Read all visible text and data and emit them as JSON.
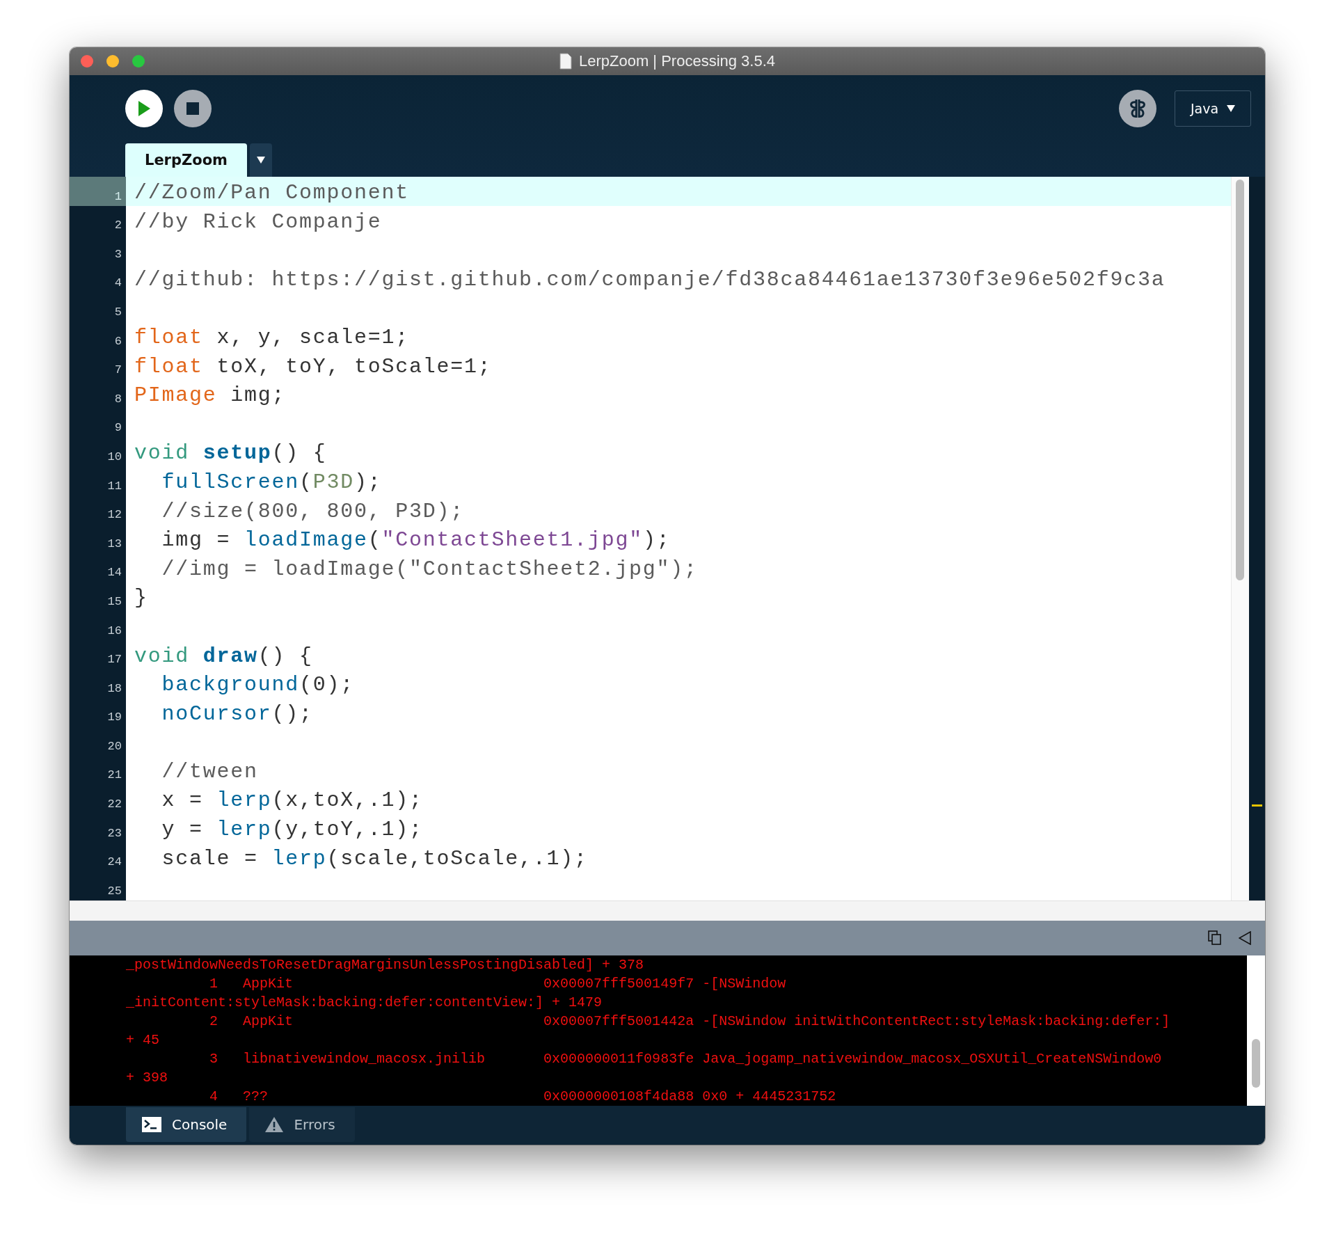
{
  "window": {
    "title": "LerpZoom | Processing 3.5.4"
  },
  "toolbar": {
    "mode": "Java"
  },
  "tabs": [
    {
      "label": "LerpZoom",
      "selected": true
    }
  ],
  "editor": {
    "lines": [
      {
        "number": "1",
        "selected": true,
        "tokens": [
          {
            "kind": "comment",
            "text": "//Zoom/Pan Component"
          }
        ]
      },
      {
        "number": "2",
        "selected": false,
        "tokens": [
          {
            "kind": "comment",
            "text": "//by Rick Companje"
          }
        ]
      },
      {
        "number": "3",
        "selected": false
      },
      {
        "number": "4",
        "selected": false,
        "tokens": [
          {
            "kind": "comment",
            "text": "//github: https://gist.github.com/companje/fd38ca84461ae13730f3e96e502f9c3a"
          }
        ]
      },
      {
        "number": "5",
        "selected": false
      },
      {
        "number": "6",
        "selected": false,
        "tokens": [
          {
            "kind": "type",
            "text": "float"
          },
          {
            "kind": "plain",
            "text": " x, y, scale=1;"
          }
        ]
      },
      {
        "number": "7",
        "selected": false,
        "tokens": [
          {
            "kind": "type",
            "text": "float"
          },
          {
            "kind": "plain",
            "text": " toX, toY, toScale=1;"
          }
        ]
      },
      {
        "number": "8",
        "selected": false,
        "tokens": [
          {
            "kind": "type",
            "text": "PImage"
          },
          {
            "kind": "plain",
            "text": " img;"
          }
        ]
      },
      {
        "number": "9",
        "selected": false
      },
      {
        "number": "10",
        "selected": false,
        "tokens": [
          {
            "kind": "keyword",
            "text": "void "
          },
          {
            "kind": "definition",
            "text": "setup"
          },
          {
            "kind": "plain",
            "text": "() {"
          }
        ]
      },
      {
        "number": "11",
        "selected": false,
        "tokens": [
          {
            "kind": "function",
            "text": "  fullScreen"
          },
          {
            "kind": "plain",
            "text": "("
          },
          {
            "kind": "constant",
            "text": "P3D"
          },
          {
            "kind": "plain",
            "text": ");"
          }
        ]
      },
      {
        "number": "12",
        "selected": false,
        "tokens": [
          {
            "kind": "comment",
            "text": "  //size(800, 800, P3D);"
          }
        ]
      },
      {
        "number": "13",
        "selected": false,
        "tokens": [
          {
            "kind": "plain",
            "text": "  img = "
          },
          {
            "kind": "function",
            "text": "loadImage"
          },
          {
            "kind": "plain",
            "text": "("
          },
          {
            "kind": "string",
            "text": "\"ContactSheet1.jpg\""
          },
          {
            "kind": "plain",
            "text": ");"
          }
        ]
      },
      {
        "number": "14",
        "selected": false,
        "tokens": [
          {
            "kind": "comment",
            "text": "  //img = loadImage(\"ContactSheet2.jpg\");"
          }
        ]
      },
      {
        "number": "15",
        "selected": false,
        "tokens": [
          {
            "kind": "plain",
            "text": "}"
          }
        ]
      },
      {
        "number": "16",
        "selected": false
      },
      {
        "number": "17",
        "selected": false,
        "tokens": [
          {
            "kind": "keyword",
            "text": "void "
          },
          {
            "kind": "definition",
            "text": "draw"
          },
          {
            "kind": "plain",
            "text": "() {"
          }
        ]
      },
      {
        "number": "18",
        "selected": false,
        "tokens": [
          {
            "kind": "function",
            "text": "  background"
          },
          {
            "kind": "plain",
            "text": "(0);"
          }
        ]
      },
      {
        "number": "19",
        "selected": false,
        "tokens": [
          {
            "kind": "function",
            "text": "  noCursor"
          },
          {
            "kind": "plain",
            "text": "();"
          }
        ]
      },
      {
        "number": "20",
        "selected": false
      },
      {
        "number": "21",
        "selected": false,
        "tokens": [
          {
            "kind": "comment",
            "text": "  //tween"
          }
        ]
      },
      {
        "number": "22",
        "selected": false,
        "tokens": [
          {
            "kind": "plain",
            "text": "  x = "
          },
          {
            "kind": "function",
            "text": "lerp"
          },
          {
            "kind": "plain",
            "text": "(x,toX,.1);"
          }
        ]
      },
      {
        "number": "23",
        "selected": false,
        "tokens": [
          {
            "kind": "plain",
            "text": "  y = "
          },
          {
            "kind": "function",
            "text": "lerp"
          },
          {
            "kind": "plain",
            "text": "(y,toY,.1);"
          }
        ]
      },
      {
        "number": "24",
        "selected": false,
        "tokens": [
          {
            "kind": "plain",
            "text": "  scale = "
          },
          {
            "kind": "function",
            "text": "lerp"
          },
          {
            "kind": "plain",
            "text": "(scale,toScale,.1);"
          }
        ]
      },
      {
        "number": "25",
        "selected": false
      }
    ]
  },
  "console": {
    "lines": [
      "_postWindowNeedsToResetDragMarginsUnlessPostingDisabled] + 378",
      "          1   AppKit                              0x00007fff500149f7 -[NSWindow",
      "_initContent:styleMask:backing:defer:contentView:] + 1479",
      "          2   AppKit                              0x00007fff5001442a -[NSWindow initWithContentRect:styleMask:backing:defer:]",
      "+ 45",
      "          3   libnativewindow_macosx.jnilib       0x000000011f0983fe Java_jogamp_nativewindow_macosx_OSXUtil_CreateNSWindow0",
      "+ 398",
      "          4   ???                                 0x0000000108f4da88 0x0 + 4445231752"
    ]
  },
  "bottom_tabs": [
    {
      "label": "Console",
      "kind": "console",
      "selected": true
    },
    {
      "label": "Errors",
      "kind": "errors",
      "selected": false
    }
  ]
}
